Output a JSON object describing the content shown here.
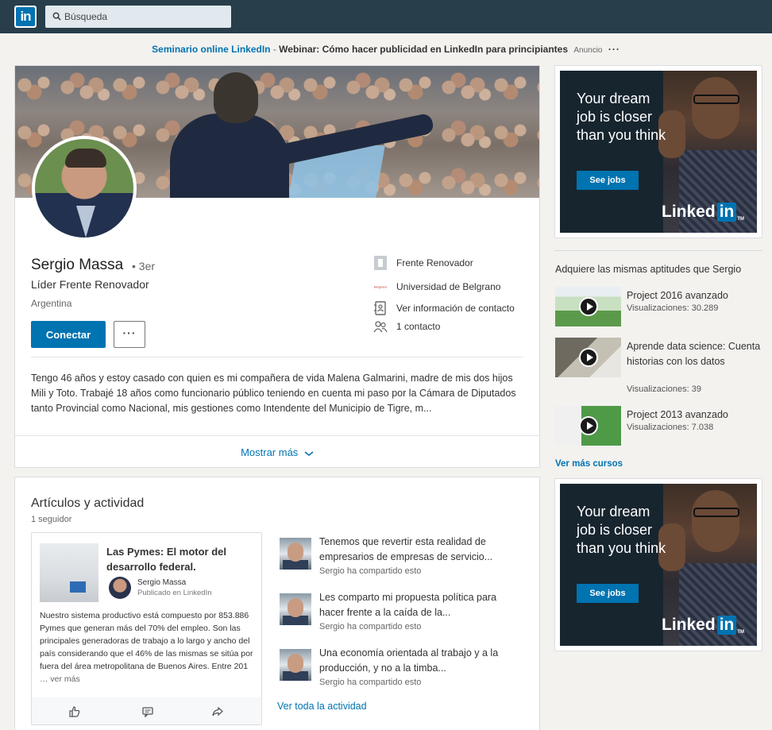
{
  "nav": {
    "logo": "in",
    "search_placeholder": "Búsqueda"
  },
  "adline": {
    "link": "Seminario online LinkedIn",
    "separator": " - ",
    "text": "Webinar: Cómo hacer publicidad en LinkedIn para principiantes",
    "label": "Anuncio",
    "more": "···"
  },
  "profile": {
    "name": "Sergio Massa",
    "degree": "• 3er",
    "headline": "Líder Frente Renovador",
    "location": "Argentina",
    "connect_label": "Conectar",
    "more_label": "···",
    "side": {
      "company": "Frente Renovador",
      "school": "Universidad de Belgrano",
      "contact_info": "Ver información de contacto",
      "connections": "1 contacto"
    },
    "summary": "Tengo 46 años y estoy casado con quien es mi compañera de vida Malena Galmarini, madre de mis dos hijos Mili y Toto. Trabajé 18 años como funcionario público teniendo en cuenta mi paso por la Cámara de Diputados tanto Provincial como Nacional, mis gestiones como Intendente del Municipio de Tigre, m...",
    "show_more": "Mostrar más"
  },
  "activity": {
    "title": "Artículos y actividad",
    "followers": "1 seguidor",
    "article": {
      "title": "Las Pymes: El motor del desarrollo federal.",
      "author": "Sergio Massa",
      "published": "Publicado en LinkedIn",
      "body": "Nuestro sistema productivo está compuesto por 853.886 Pymes que generan más del 70% del empleo. Son las principales generadoras de trabajo a lo largo y ancho del país considerando que el 46% de las mismas se sitúa por fuera del área metropolitana de Buenos Aires. Entre 201",
      "more": "… ver más"
    },
    "feed": [
      {
        "text": "Tenemos que revertir esta realidad de empresarios de empresas de servicio...",
        "sub": "Sergio ha compartido esto"
      },
      {
        "text": "Les comparto mi propuesta política para hacer frente a la caída de la...",
        "sub": "Sergio ha compartido esto"
      },
      {
        "text": "Una economía orientada al trabajo y a la producción, y no a la timba...",
        "sub": "Sergio ha compartido esto"
      }
    ],
    "see_all": "Ver toda la actividad"
  },
  "right_ads": [
    {
      "headline": "Your dream job is closer than you think",
      "button": "See jobs",
      "brand": "Linked",
      "brand_in": "in",
      "tm": "TM"
    },
    {
      "headline": "Your dream job is closer than you think",
      "button": "See jobs",
      "brand": "Linked",
      "brand_in": "in",
      "tm": "TM"
    }
  ],
  "courses": {
    "title": "Adquiere las mismas aptitudes que Sergio",
    "items": [
      {
        "title": "Project 2016 avanzado",
        "views": "Visualizaciones: 30.289"
      },
      {
        "title": "Aprende data science: Cuenta historias con los datos",
        "views": "Visualizaciones: 39"
      },
      {
        "title": "Project 2013 avanzado",
        "views": "Visualizaciones: 7.038"
      }
    ],
    "see_more": "Ver más cursos"
  }
}
